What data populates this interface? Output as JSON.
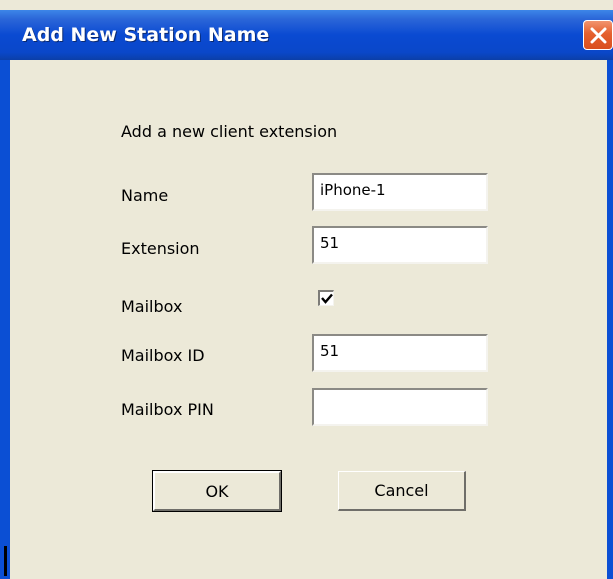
{
  "window": {
    "title": "Add New Station Name"
  },
  "dialog": {
    "heading": "Add a new client extension",
    "fields": {
      "name": {
        "label": "Name",
        "value": "iPhone-1"
      },
      "extension": {
        "label": "Extension",
        "value": "51"
      },
      "mailbox": {
        "label": "Mailbox",
        "checked": true
      },
      "mailbox_id": {
        "label": "Mailbox ID",
        "value": "51"
      },
      "mailbox_pin": {
        "label": "Mailbox PIN",
        "value": ""
      }
    },
    "buttons": {
      "ok": "OK",
      "cancel": "Cancel"
    }
  },
  "colors": {
    "titlebar": "#0a4ad2",
    "dialog_bg": "#ece9d8",
    "close": "#e5602e"
  },
  "icons": {
    "close": "close-x-icon",
    "check": "checkmark-icon"
  }
}
